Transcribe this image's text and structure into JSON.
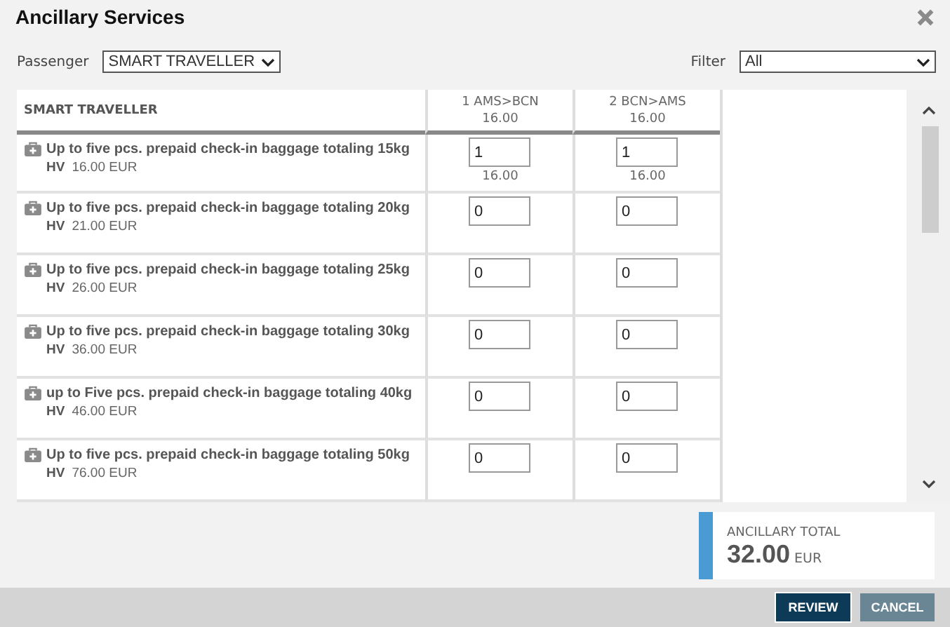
{
  "dialog": {
    "title": "Ancillary Services"
  },
  "passenger": {
    "label": "Passenger",
    "value": "SMART TRAVELLER"
  },
  "filter": {
    "label": "Filter",
    "value": "All"
  },
  "table": {
    "columns": [
      {
        "label": "SMART TRAVELLER"
      },
      {
        "label": "1 AMS>BCN",
        "price": "16.00"
      },
      {
        "label": "2 BCN>AMS",
        "price": "16.00"
      }
    ],
    "rows": [
      {
        "name": "Up to five pcs. prepaid check-in baggage totaling 15kg",
        "code": "HV",
        "price": "16.00 EUR",
        "quantities": [
          "1",
          "1"
        ],
        "subtotals": [
          "16.00",
          "16.00"
        ]
      },
      {
        "name": "Up to five pcs. prepaid check-in baggage totaling 20kg",
        "code": "HV",
        "price": "21.00 EUR",
        "quantities": [
          "0",
          "0"
        ]
      },
      {
        "name": "Up to five pcs. prepaid check-in baggage totaling 25kg",
        "code": "HV",
        "price": "26.00 EUR",
        "quantities": [
          "0",
          "0"
        ]
      },
      {
        "name": "Up to five pcs. prepaid check-in baggage totaling 30kg",
        "code": "HV",
        "price": "36.00 EUR",
        "quantities": [
          "0",
          "0"
        ]
      },
      {
        "name": "up to Five pcs. prepaid check-in baggage totaling 40kg",
        "code": "HV",
        "price": "46.00 EUR",
        "quantities": [
          "0",
          "0"
        ]
      },
      {
        "name": "Up to five pcs. prepaid check-in baggage totaling 50kg",
        "code": "HV",
        "price": "76.00 EUR",
        "quantities": [
          "0",
          "0"
        ]
      }
    ]
  },
  "total": {
    "label": "ANCILLARY TOTAL",
    "amount": "32.00",
    "currency": "EUR"
  },
  "buttons": [
    {
      "label": "REVIEW",
      "kind": "primary"
    },
    {
      "label": "CANCEL",
      "kind": "secondary"
    }
  ]
}
